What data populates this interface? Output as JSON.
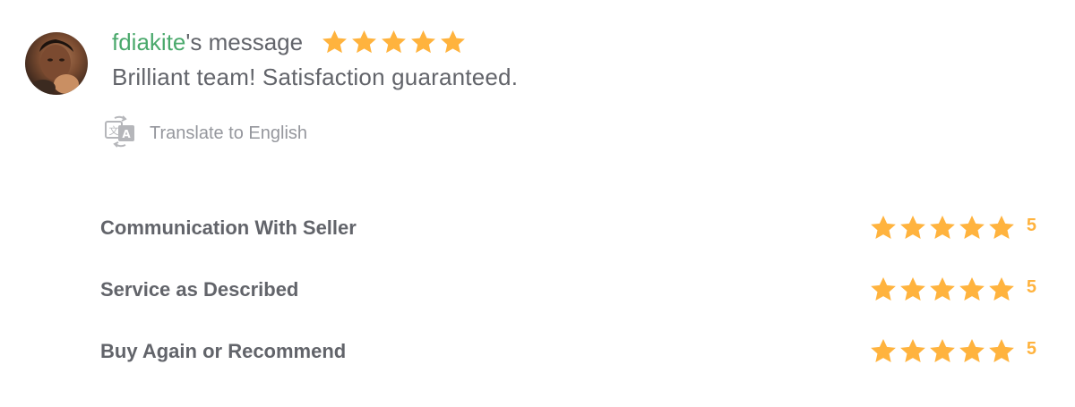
{
  "review": {
    "username": "fdiakite",
    "suffix": "'s message",
    "stars": 5,
    "message": "Brilliant team! Satisfaction guaranteed.",
    "translate_label": "Translate to English"
  },
  "ratings": [
    {
      "label": "Communication With Seller",
      "stars": 5,
      "value": "5"
    },
    {
      "label": "Service as Described",
      "stars": 5,
      "value": "5"
    },
    {
      "label": "Buy Again or Recommend",
      "stars": 5,
      "value": "5"
    }
  ],
  "icons": {
    "star": "star-icon",
    "translate": "translate-icon"
  },
  "colors": {
    "username": "#4aa96c",
    "star": "#ffb33e",
    "text": "#62646a",
    "muted": "#95979d"
  }
}
